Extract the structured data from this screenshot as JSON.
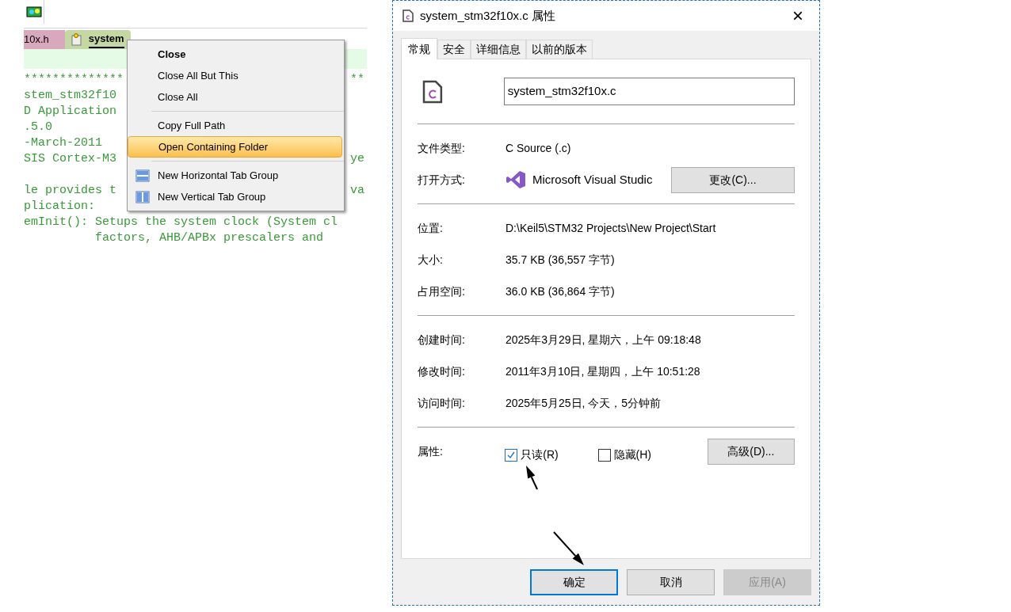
{
  "editor": {
    "tabs": [
      {
        "label": "10x.h",
        "selected": false
      },
      {
        "label": "system",
        "selected": true
      }
    ],
    "code_blocks": [
      [
        {
          "left": "**************",
          "right": "**"
        },
        {
          "left": "stem_stm32f10"
        },
        {
          "left": "D Application"
        },
        {
          "left": ".5.0"
        },
        {
          "left": "-March-2011"
        },
        {
          "left": "SIS Cortex-M3",
          "right": "ye"
        }
      ],
      [
        {
          "left": "le provides t",
          "right": "va"
        },
        {
          "left": "plication:"
        },
        {
          "left": "emInit(): Setups the system clock (System cl"
        },
        {
          "left": "          factors, AHB/APBx prescalers and"
        }
      ]
    ]
  },
  "context_menu": {
    "groups": [
      [
        {
          "label": "Close",
          "bold": true,
          "highlighted": false
        },
        {
          "label": "Close All But This",
          "bold": false,
          "highlighted": false
        },
        {
          "label": "Close All",
          "bold": false,
          "highlighted": false
        }
      ],
      [
        {
          "label": "Copy Full Path",
          "bold": false,
          "highlighted": false
        },
        {
          "label": "Open Containing Folder",
          "bold": false,
          "highlighted": true
        }
      ],
      [
        {
          "label": "New Horizontal Tab Group",
          "bold": false,
          "highlighted": false,
          "kind": "horizontal"
        },
        {
          "label": "New Vertical Tab Group",
          "bold": false,
          "highlighted": false,
          "kind": "vertical"
        }
      ]
    ]
  },
  "dialog": {
    "title": "system_stm32f10x.c 属性",
    "close": "×",
    "tabs": [
      {
        "label": "常规",
        "selected": true
      },
      {
        "label": "安全",
        "selected": false
      },
      {
        "label": "详细信息",
        "selected": false
      },
      {
        "label": "以前的版本",
        "selected": false
      }
    ],
    "file_name": "system_stm32f10x.c",
    "sections": [
      [
        {
          "label": "文件类型:",
          "value": "C Source (.c)"
        },
        {
          "label": "打开方式:",
          "value": "Microsoft Visual Studic",
          "button": "更改(C)..."
        }
      ],
      [
        {
          "label": "位置:",
          "value": "D:\\Keil5\\STM32 Projects\\New Project\\Start"
        },
        {
          "label": "大小:",
          "value": "35.7 KB (36,557 字节)"
        },
        {
          "label": "占用空间:",
          "value": "36.0 KB (36,864 字节)"
        }
      ],
      [
        {
          "label": "创建时间:",
          "value": "2025年3月29日, 星期六，上午 09:18:48"
        },
        {
          "label": "修改时间:",
          "value": "2011年3月10日, 星期四，上午 10:51:28"
        },
        {
          "label": "访问时间:",
          "value": "2025年5月25日, 今天，5分钟前"
        }
      ]
    ],
    "attributes": {
      "label": "属性:",
      "checkboxes": [
        {
          "label": "只读(R)",
          "checked": true
        },
        {
          "label": "隐藏(H)",
          "checked": false
        }
      ],
      "button": "高级(D)..."
    },
    "buttons": [
      {
        "label": "确定",
        "disabled": false,
        "focused": true
      },
      {
        "label": "取消",
        "disabled": false,
        "focused": false
      },
      {
        "label": "应用(A)",
        "disabled": true,
        "focused": false
      }
    ]
  }
}
